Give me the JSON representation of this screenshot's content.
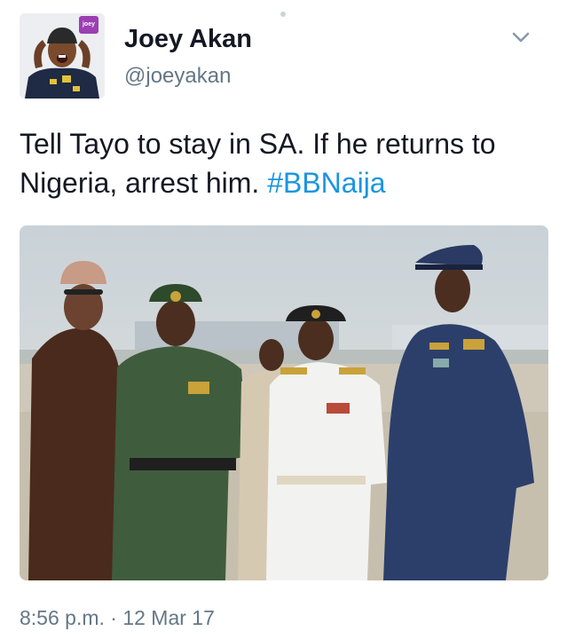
{
  "author": {
    "name": "Joey Akan",
    "handle": "@joeyakan",
    "avatar_badge": "joey"
  },
  "tweet": {
    "text": "Tell Tayo to stay in SA. If he returns to Nigeria, arrest him. ",
    "hashtag": "#BBNaija"
  },
  "meta": {
    "timestamp": "8:56 p.m. · 12 Mar 17"
  },
  "colors": {
    "link": "#1b95e0",
    "secondary_text": "#657786",
    "primary_text": "#141823"
  },
  "icons": {
    "menu": "chevron-down-icon"
  }
}
